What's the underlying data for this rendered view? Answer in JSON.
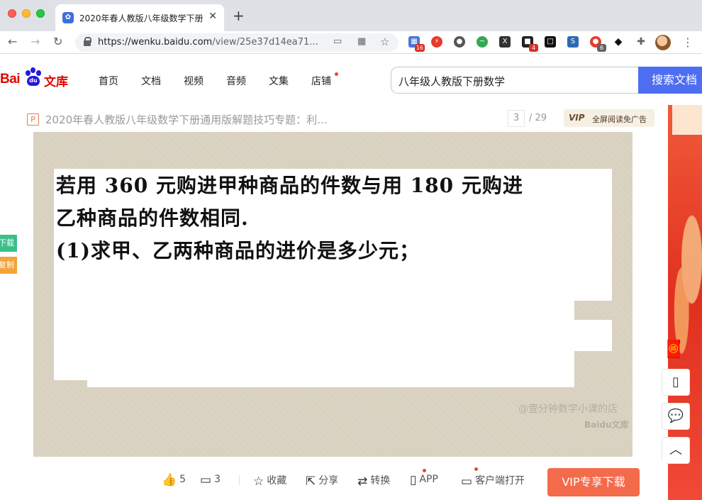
{
  "browser": {
    "tab_title": "2020年春人教版八年级数学下册",
    "tab_favicon": "baidu-paw-icon",
    "url_host": "https://wenku.baidu.com",
    "url_path": "/view/25e37d14ea71...",
    "extension_badges": [
      "16",
      "4",
      "6"
    ]
  },
  "site": {
    "logo_bai": "Bai",
    "logo_du": "du",
    "logo_wenku": "文库",
    "nav": [
      "首页",
      "文档",
      "视频",
      "音频",
      "文集",
      "店铺"
    ],
    "search_value": "八年级人教版下册数学",
    "search_button": "搜索文档"
  },
  "doc": {
    "type_badge": "P",
    "title": "2020年春人教版八年级数学下册通用版解题技巧专题：利…",
    "page_current": "3",
    "page_total": "/ 29",
    "vip_logo": "VIP",
    "vip_ad": "全屏阅读免广告",
    "content_lines": [
      "若用 360 元购进甲种商品的件数与用 180 元购进",
      "乙种商品的件数相同.",
      "(1)求甲、乙两种商品的进价是多少元；"
    ],
    "watermark_shop": "@壹分钟数学小课的店",
    "watermark_logo": "Baidu文库"
  },
  "side_left": {
    "download": "下载",
    "copy": "复制"
  },
  "actions": {
    "like_count": "5",
    "comment_count": "3",
    "favorite": "收藏",
    "share": "分享",
    "convert": "转换",
    "app": "APP",
    "client_open": "客户端打开",
    "vip_download": "VIP专享下载"
  },
  "colors": {
    "baidu_red": "#e10602",
    "baidu_blue": "#2319dc",
    "search_button": "#4e6ef2",
    "vip_download": "#f46b4b",
    "promo_red": "#e0301e"
  }
}
